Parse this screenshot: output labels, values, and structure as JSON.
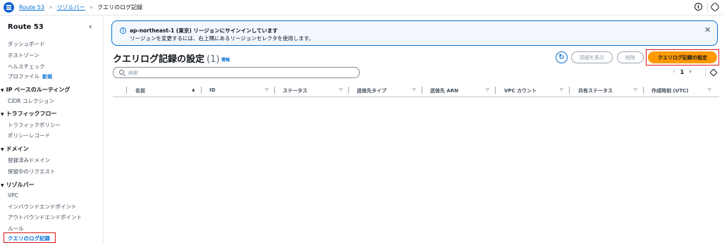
{
  "breadcrumb": {
    "items": [
      "Route 53",
      "リゾルバー"
    ],
    "current": "クエリのログ記録"
  },
  "sidebar": {
    "title": "Route 53",
    "top_items": [
      {
        "label": "ダッシュボード"
      },
      {
        "label": "ホストゾーン"
      },
      {
        "label": "ヘルスチェック"
      },
      {
        "label": "プロファイル",
        "badge": "新規"
      }
    ],
    "sections": [
      {
        "title": "IP ベースのルーティング",
        "items": [
          "CIDR コレクション"
        ]
      },
      {
        "title": "トラフィックフロー",
        "items": [
          "トラフィックポリシー",
          "ポリシーレコード"
        ]
      },
      {
        "title": "ドメイン",
        "items": [
          "登録済みドメイン",
          "保留中のリクエスト"
        ]
      },
      {
        "title": "リゾルバー",
        "items": [
          "VPC",
          "インバウンドエンドポイント",
          "アウトバウンドエンドポイント",
          "ルール",
          "クエリのログ記録"
        ]
      }
    ]
  },
  "flash": {
    "title": "ap-northeast-1 (東京) リージョンにサインインしています",
    "body": "リージョンを変更するには、右上隅にあるリージョンセレクタを使用します。"
  },
  "header": {
    "title": "クエリログ記録の設定",
    "count": "(1)",
    "info": "情報"
  },
  "actions": {
    "details": "詳細を表示",
    "delete": "削除",
    "configure": "クエリログ記録の設定"
  },
  "search": {
    "placeholder": "検索"
  },
  "pagination": {
    "page": "1"
  },
  "table": {
    "columns": [
      "名前",
      "ID",
      "ステータス",
      "送信先タイプ",
      "送信先 ARN",
      "VPC カウント",
      "共有ステータス",
      "作成時刻 (UTC)"
    ]
  },
  "colors": {
    "accent": "#0972d3",
    "primary_button": "#ff9900",
    "highlight": "#d91515"
  }
}
